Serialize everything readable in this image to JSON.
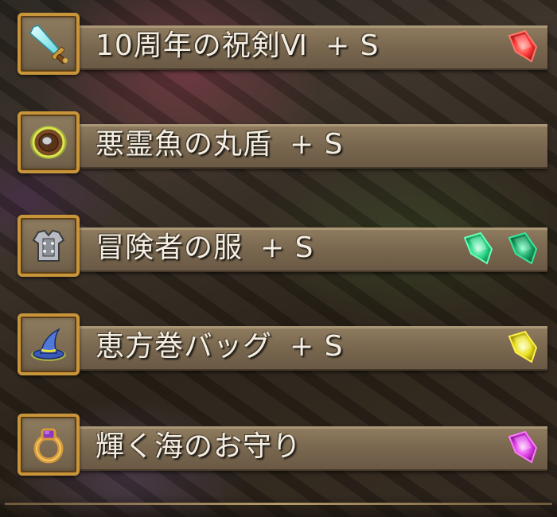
{
  "colors": {
    "frame_gold": "#c9953b",
    "bar": "#7a6850",
    "text": "#f4eee2"
  },
  "items": [
    {
      "name": "10周年の祝剣Ⅵ",
      "suffix": "+ S",
      "icon": "sword-icon",
      "gems": [
        {
          "color": "#ff3b3b",
          "glow": "#ff6a5a"
        }
      ]
    },
    {
      "name": "悪霊魚の丸盾",
      "suffix": "+ S",
      "icon": "round-shield-icon",
      "gems": []
    },
    {
      "name": "冒険者の服",
      "suffix": "+ S",
      "icon": "armor-icon",
      "gems": [
        {
          "color": "#2fd88a",
          "glow": "#4dffa8"
        },
        {
          "color": "#1fa86a",
          "glow": "#2ddc8c"
        }
      ]
    },
    {
      "name": "恵方巻バッグ",
      "suffix": "+ S",
      "icon": "wizard-hat-icon",
      "gems": [
        {
          "color": "#e8e020",
          "glow": "#fff04a"
        }
      ]
    },
    {
      "name": "輝く海のお守り",
      "suffix": "",
      "icon": "ring-icon",
      "gems": [
        {
          "color": "#e040e8",
          "glow": "#ff6aff"
        }
      ]
    }
  ]
}
